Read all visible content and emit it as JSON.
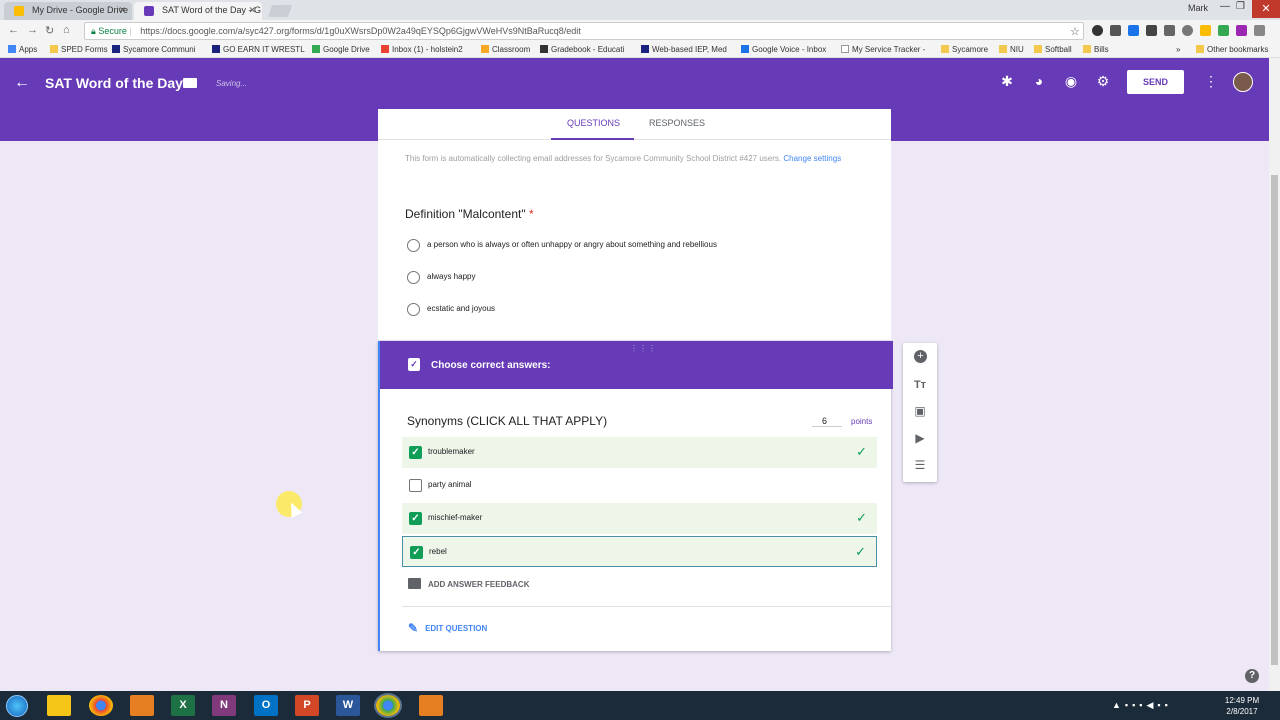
{
  "browser": {
    "tabs": [
      {
        "title": "My Drive - Google Drive",
        "color": "#2e7d32"
      },
      {
        "title": "SAT Word of the Day - G",
        "color": "#673ab7"
      }
    ],
    "user": "Mark",
    "secure_label": "Secure",
    "url": "https://docs.google.com/a/syc427.org/forms/d/1g0uXWsrsDp0W2a49qEYSQp6GjgwVWeHVs9NtBaRucq8/edit",
    "bookmarks": [
      "Apps",
      "SPED Forms",
      "Sycamore Communi",
      "GO EARN IT WRESTL",
      "Google Drive",
      "Inbox (1) - holstein2",
      "Classroom",
      "Gradebook - Educati",
      "Web-based IEP, Med",
      "Google Voice - Inbox",
      "My Service Tracker -",
      "Sycamore",
      "NIU",
      "Softball",
      "Bills",
      "»",
      "Other bookmarks"
    ]
  },
  "app": {
    "form_title": "SAT Word of the Day",
    "status": "Saving...",
    "send_label": "SEND",
    "tabs": [
      "QUESTIONS",
      "RESPONSES"
    ],
    "accent": "#673ab7"
  },
  "form": {
    "notice": "This form is automatically collecting email addresses for Sycamore Community School District #427 users.",
    "notice_link": "Change settings",
    "q1": {
      "title": "Definition \"Malcontent\"",
      "required_mark": "*",
      "options": [
        "a person who is always or often unhappy or angry about something and rebellious",
        "always happy",
        "ecstatic and joyous"
      ]
    },
    "answer_key": {
      "header": "Choose correct answers:",
      "drag_handle": "⋮⋮⋮",
      "question": "Synonyms (CLICK ALL THAT APPLY)",
      "points_value": "6",
      "points_label": "points",
      "answers": [
        {
          "label": "troublemaker",
          "correct": true
        },
        {
          "label": "party animal",
          "correct": false
        },
        {
          "label": "mischief-maker",
          "correct": true
        },
        {
          "label": "rebel",
          "correct": true
        }
      ],
      "feedback_label": "ADD ANSWER FEEDBACK",
      "edit_label": "EDIT QUESTION"
    }
  },
  "taskbar": {
    "apps": [
      "file-explorer",
      "chrome",
      "media-player",
      "excel",
      "onenote",
      "outlook",
      "powerpoint",
      "word",
      "chrome-active",
      "snipping-tool"
    ],
    "time": "12:49 PM",
    "date": "2/8/2017"
  }
}
